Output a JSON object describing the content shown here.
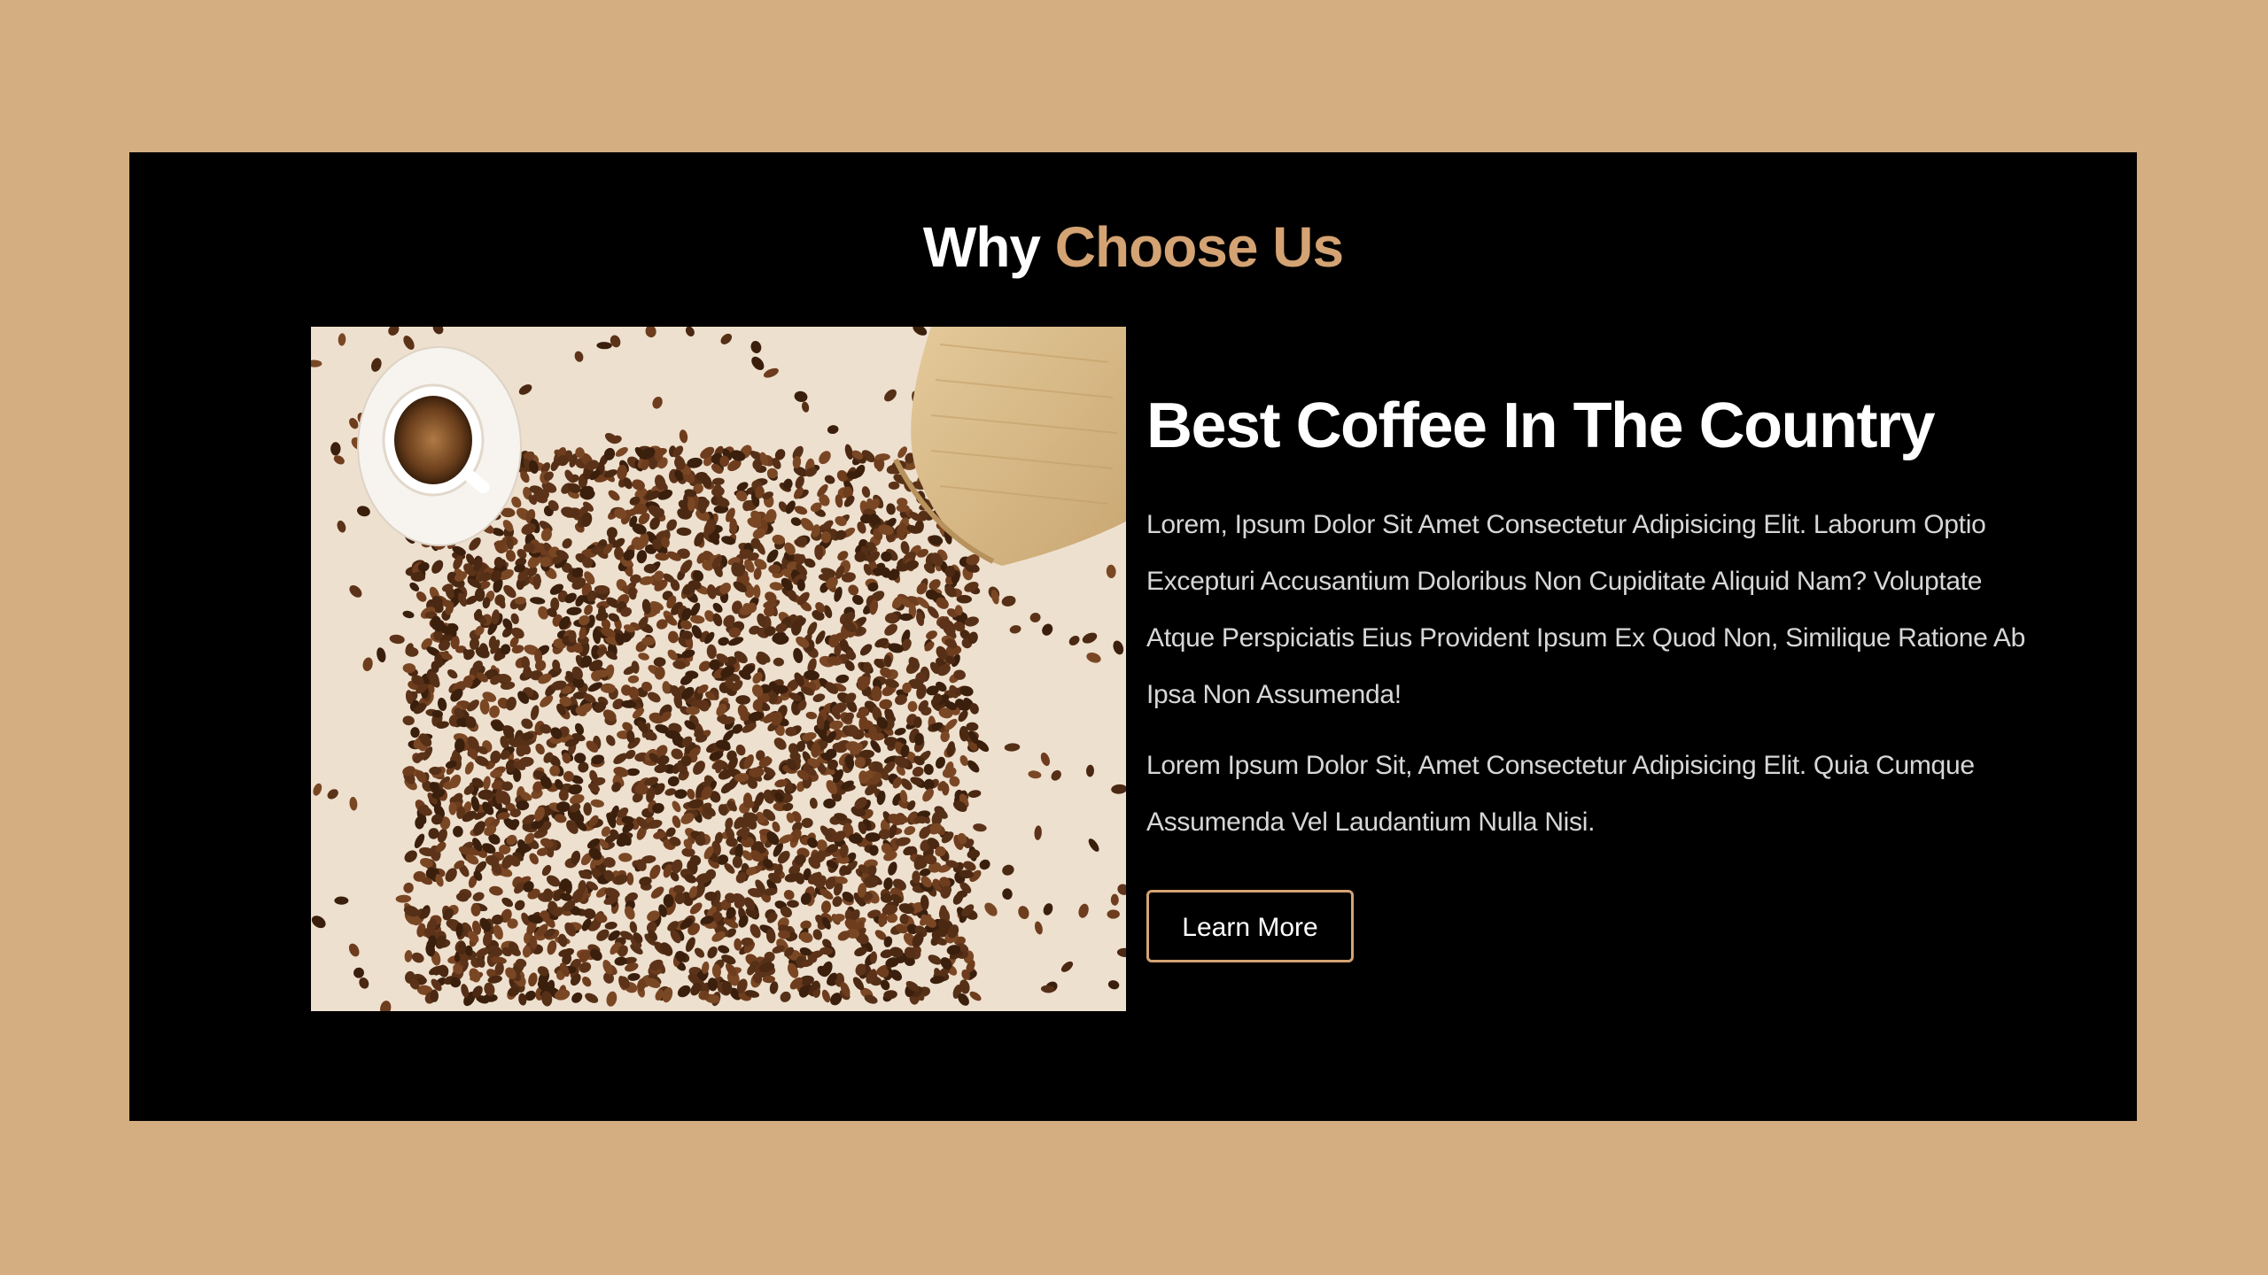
{
  "section": {
    "heading_plain": "Why",
    "heading_accent": "Choose Us"
  },
  "feature": {
    "title": "Best Coffee In The Country",
    "paragraph_1": "Lorem, Ipsum Dolor Sit Amet Consectetur Adipisicing Elit. Laborum Optio Excepturi Accusantium Doloribus Non Cupiditate Aliquid Nam? Voluptate Atque Perspiciatis Eius Provident Ipsum Ex Quod Non, Similique Ratione Ab Ipsa Non Assumenda!",
    "paragraph_2": "Lorem Ipsum Dolor Sit, Amet Consectetur Adipisicing Elit. Quia Cumque Assumenda Vel Laudantium Nulla Nisi.",
    "button_label": "Learn More"
  },
  "colors": {
    "page_background": "#d4ae80",
    "panel_background": "#000000",
    "accent": "#d4a373",
    "heading_text": "#ffffff",
    "body_text": "#d7d7d7"
  }
}
